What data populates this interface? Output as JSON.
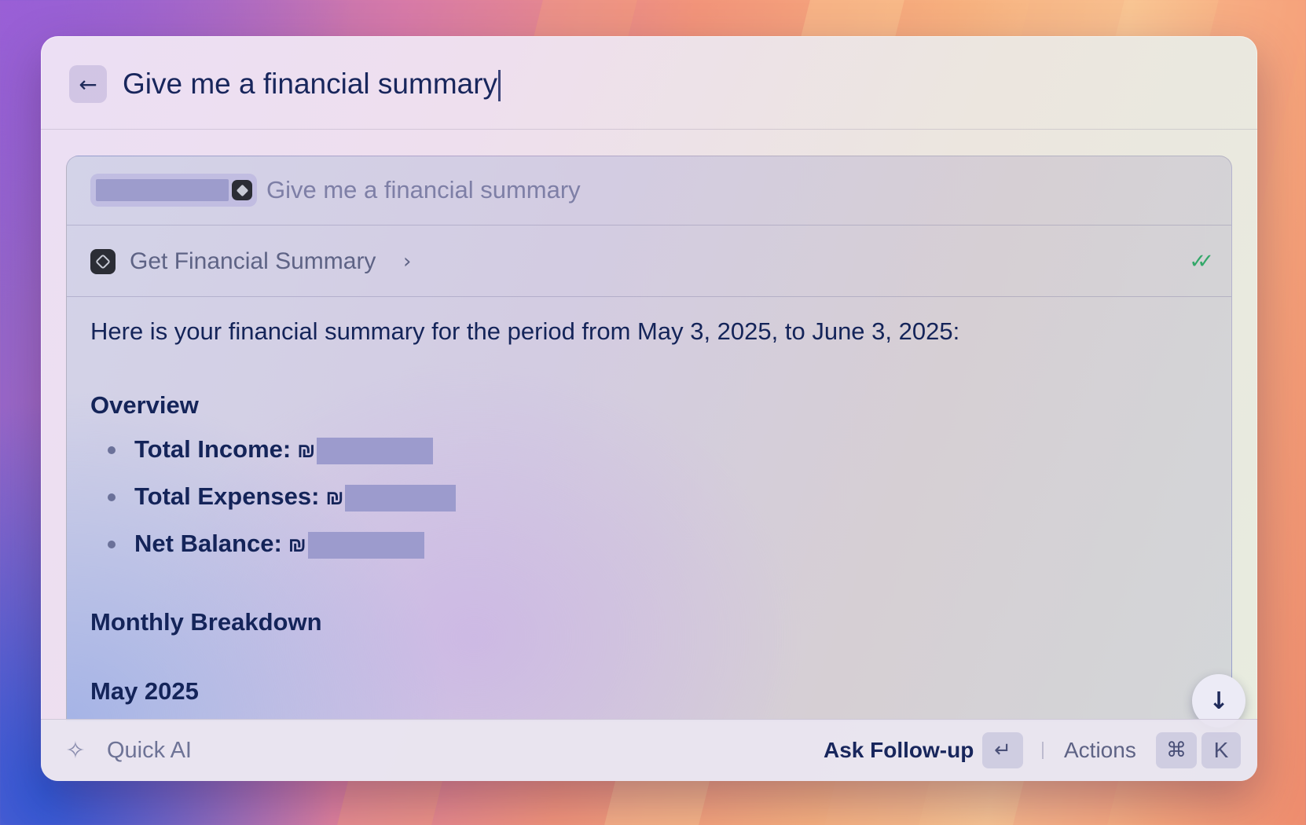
{
  "header": {
    "back_icon": "arrow-left-icon",
    "query": "Give me a financial summary"
  },
  "prompt": {
    "text": "Give me a financial summary",
    "chip_icon": "extension-icon"
  },
  "tool": {
    "label": "Get Financial Summary",
    "chevron": "›",
    "status_icon": "double-check-icon",
    "status_color": "#34a86a"
  },
  "response": {
    "intro": "Here is your financial summary for the period from May 3, 2025, to June 3, 2025:",
    "overview_heading": "Overview",
    "items": [
      {
        "label": "Total Income:",
        "currency": "₪"
      },
      {
        "label": "Total Expenses:",
        "currency": "₪"
      },
      {
        "label": "Net Balance:",
        "currency": "₪"
      }
    ],
    "monthly_heading": "Monthly Breakdown",
    "month_heading": "May 2025"
  },
  "footer": {
    "app_name": "Quick AI",
    "ask_label": "Ask Follow-up",
    "enter_key": "↵",
    "actions_label": "Actions",
    "cmd_key": "⌘",
    "k_key": "K"
  },
  "colors": {
    "text_primary": "#142459",
    "redaction": "#9c9bcd",
    "success": "#34a86a"
  }
}
